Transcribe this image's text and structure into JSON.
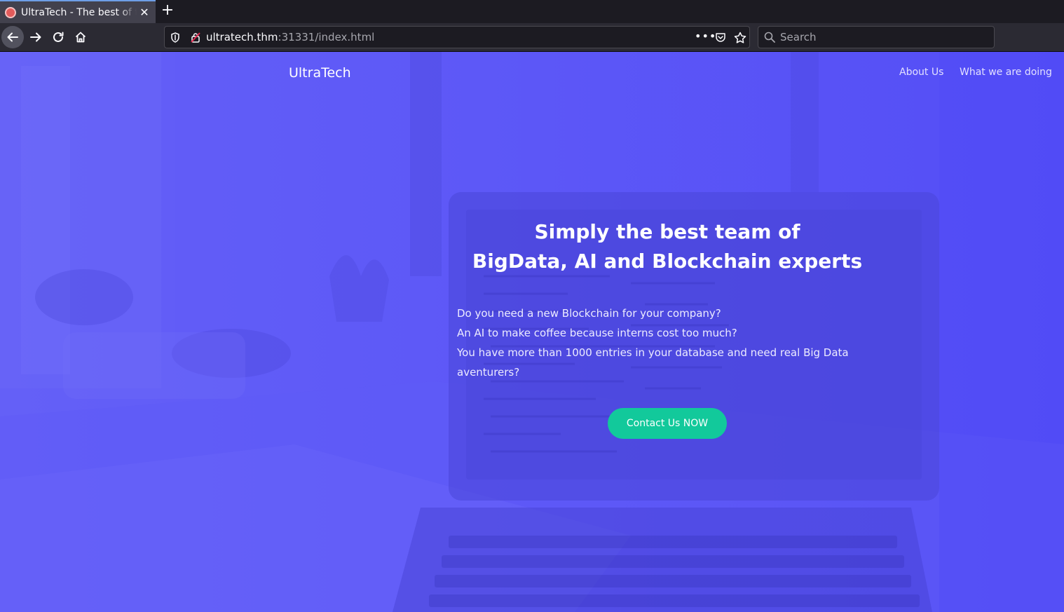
{
  "browser": {
    "tab": {
      "title": "UltraTech - The best of tech",
      "favicon": "ultratech-favicon-icon"
    },
    "new_tab_label": "+",
    "url": {
      "host": "ultratech.thm",
      "rest": ":31331/index.html"
    },
    "page_actions_label": "•••",
    "search": {
      "placeholder": "Search"
    }
  },
  "page": {
    "brand": "UltraTech",
    "nav": [
      {
        "label": "About Us"
      },
      {
        "label": "What we are doing"
      }
    ],
    "hero": {
      "title_lines": [
        "Simply the best team of",
        "BigData, AI and Blockchain experts"
      ],
      "body_lines": [
        "Do you need a new Blockchain for your company?",
        "An AI to make coffee because interns cost too much?",
        "You have more than 1000 entries in your database and need real Big Data",
        "aventurers?"
      ],
      "cta": "Contact Us NOW"
    }
  },
  "colors": {
    "hero_overlay": "#5d58f7",
    "cta": "#12c99b",
    "chrome_dark": "#1c1b22",
    "toolbar": "#2b2a33",
    "tab_active": "#42414d"
  }
}
